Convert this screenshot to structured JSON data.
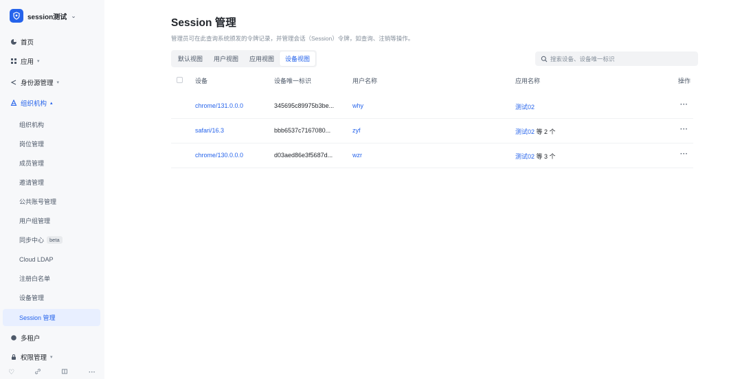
{
  "app": {
    "name": "session测试"
  },
  "sidebar": {
    "items": [
      {
        "label": "首页",
        "icon": "home-icon"
      },
      {
        "label": "应用",
        "icon": "apps-icon"
      },
      {
        "label": "身份源管理",
        "icon": "share-icon"
      },
      {
        "label": "组织机构",
        "icon": "org-icon"
      }
    ],
    "org_children": [
      {
        "label": "组织机构"
      },
      {
        "label": "岗位管理"
      },
      {
        "label": "成员管理"
      },
      {
        "label": "邀请管理"
      },
      {
        "label": "公共账号管理"
      },
      {
        "label": "用户组管理"
      },
      {
        "label": "同步中心",
        "badge": "beta"
      },
      {
        "label": "Cloud LDAP"
      },
      {
        "label": "注册白名单"
      },
      {
        "label": "设备管理"
      },
      {
        "label": "Session 管理"
      }
    ],
    "bottom_items": [
      {
        "label": "多租户",
        "icon": "tenant-icon"
      },
      {
        "label": "权限管理",
        "icon": "permission-icon"
      }
    ]
  },
  "page": {
    "title": "Session 管理",
    "description": "管理员可在此查询系统颁发的令牌记录，并管理会话（Session）令牌，如查询、注销等操作。"
  },
  "tabs": [
    {
      "label": "默认视图"
    },
    {
      "label": "用户视图"
    },
    {
      "label": "应用视图"
    },
    {
      "label": "设备视图",
      "active": true
    }
  ],
  "search": {
    "placeholder": "搜索设备、设备唯一标识"
  },
  "table": {
    "headers": {
      "device": "设备",
      "device_id": "设备唯一标识",
      "user": "用户名称",
      "app": "应用名称",
      "actions": "操作"
    },
    "rows": [
      {
        "device": "chrome/131.0.0.0",
        "device_id": "345695c89975b3be...",
        "user": "why",
        "app": "测试02",
        "app_more": ""
      },
      {
        "device": "safari/16.3",
        "device_id": "bbb6537c7167080...",
        "user": "zyf",
        "app": "测试02",
        "app_more": "等 2 个"
      },
      {
        "device": "chrome/130.0.0.0",
        "device_id": "d03aed86e3f5687d...",
        "user": "wzr",
        "app": "测试02",
        "app_more": "等 3 个"
      }
    ],
    "more_label": "···"
  }
}
